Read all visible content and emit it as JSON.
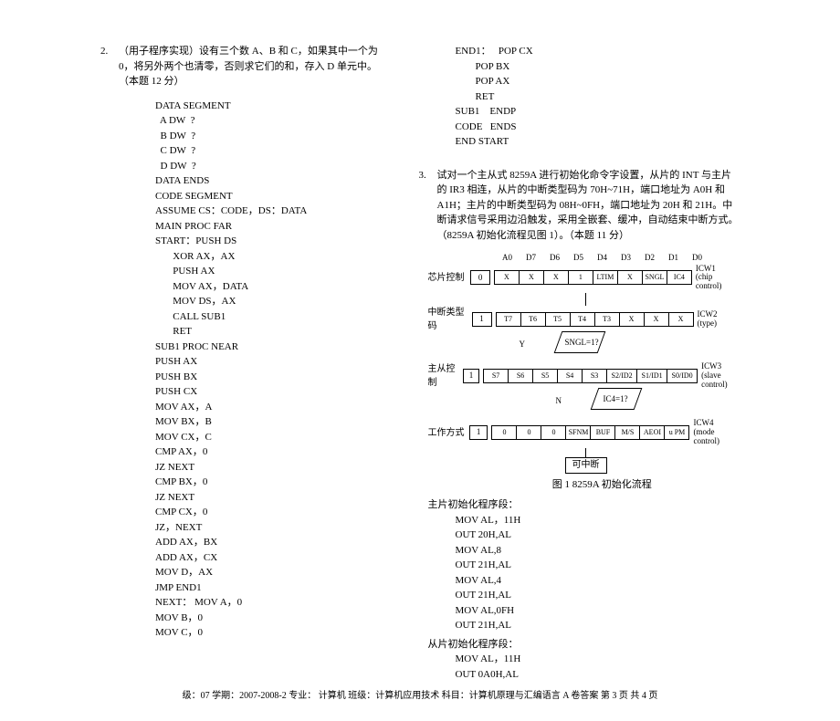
{
  "q2": {
    "num": "2.",
    "text": "（用子程序实现）设有三个数 A、B 和 C，如果其中一个为 0，将另外两个也清零，否则求它们的和，存入 D 单元中。（本题 12 分）",
    "code": "DATA SEGMENT\n  A DW  ?\n  B DW  ?\n  C DW  ?\n  D DW  ?\nDATA ENDS\nCODE SEGMENT\nASSUME CS：CODE，DS：DATA\nMAIN PROC FAR\nSTART：PUSH DS\n       XOR AX，AX\n       PUSH AX\n       MOV AX，DATA\n       MOV DS，AX\n       CALL SUB1\n       RET\nSUB1 PROC NEAR\nPUSH AX\nPUSH BX\nPUSH CX\nMOV AX，A\nMOV BX，B\nMOV CX，C\nCMP AX，0\nJZ NEXT\nCMP BX，0\nJZ NEXT\nCMP CX，0\nJZ，NEXT\nADD AX，BX\nADD AX，CX\nMOV D，AX\nJMP END1\nNEXT： MOV A，0\nMOV B，0\nMOV C，0",
    "code_right": "END1：   POP CX\n        POP BX\n        POP AX\n        RET\nSUB1    ENDP\nCODE   ENDS\nEND START"
  },
  "q3": {
    "num": "3.",
    "text": "试对一个主从式 8259A 进行初始化命令字设置，从片的 INT 与主片的 IR3 相连，从片的中断类型码为 70H~71H，端口地址为 A0H 和 A1H；主片的中断类型码为 08H~0FH，端口地址为 20H 和 21H。中断请求信号采用边沿触发，采用全嵌套、缓冲，自动结束中断方式。（8259A 初始化流程见图 1）。（本题 11 分）",
    "bit_headers": [
      "A0",
      "D7",
      "D6",
      "D5",
      "D4",
      "D3",
      "D2",
      "D1",
      "D0"
    ],
    "rows": {
      "icw1": {
        "label": "芯片控制",
        "addr": "0",
        "cells": [
          "X",
          "X",
          "X",
          "1",
          "LTIM",
          "X",
          "SNGL",
          "IC4"
        ],
        "lbl": "ICW1",
        "sub": "(chip control)"
      },
      "icw2": {
        "label": "中断类型码",
        "addr": "1",
        "cells": [
          "T7",
          "T6",
          "T5",
          "T4",
          "T3",
          "X",
          "X",
          "X"
        ],
        "lbl": "ICW2",
        "sub": "(type)"
      },
      "icw3": {
        "label": "主从控制",
        "addr": "1",
        "cells": [
          "S7",
          "S6",
          "S5",
          "S4",
          "S3",
          "S2/ID2",
          "S1/ID1",
          "S0/ID0"
        ],
        "lbl": "ICW3",
        "sub": "(slave control)"
      },
      "icw4": {
        "label": "工作方式",
        "addr": "1",
        "cells": [
          "0",
          "0",
          "0",
          "SFNM",
          "BUF",
          "M/S",
          "AEOI",
          "u PM"
        ],
        "lbl": "ICW4",
        "sub": "(mode control)"
      }
    },
    "dec1": "SNGL=1?",
    "dec2": "IC4=1?",
    "dec1_y": "Y",
    "dec1_n": "N",
    "endbox": "可中断",
    "figcap": "图 1    8259A 初始化流程",
    "seg1_title": "主片初始化程序段：",
    "seg1": "MOV AL，11H\nOUT 20H,AL\nMOV AL,8\nOUT 21H,AL\nMOV AL,4\nOUT 21H,AL\nMOV AL,0FH\nOUT 21H,AL",
    "seg2_title": "从片初始化程序段：",
    "seg2": "MOV AL，11H\nOUT 0A0H,AL"
  },
  "footer": "级：07   学期：2007-2008-2   专业：  计算机    班级：计算机应用技术    科目：计算机原理与汇编语言      A 卷答案       第 3 页    共 4 页"
}
